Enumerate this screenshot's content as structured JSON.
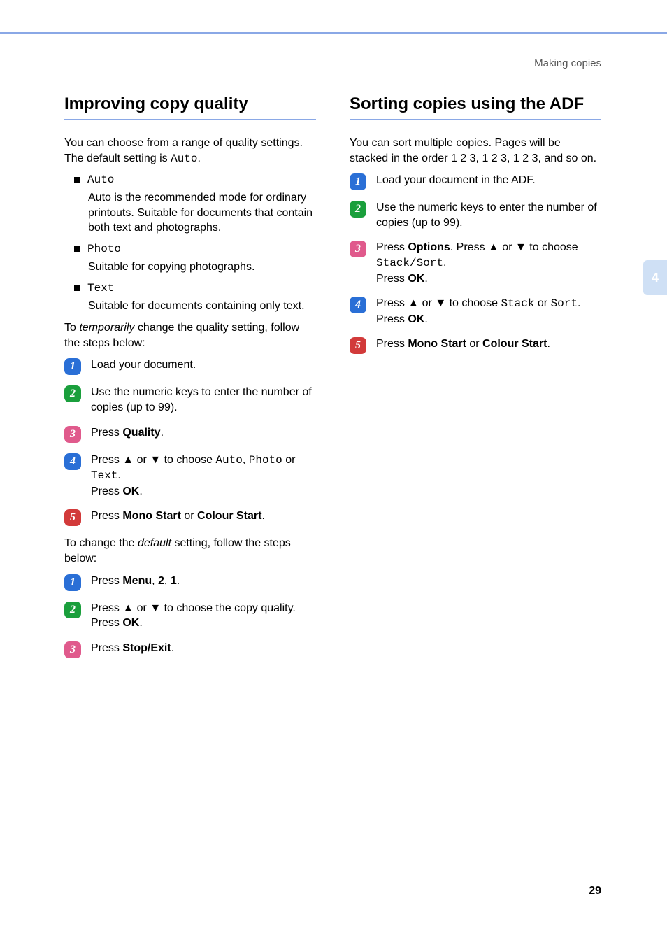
{
  "breadcrumb": "Making copies",
  "page_number": "29",
  "side_tab": "4",
  "left": {
    "heading": "Improving copy quality",
    "intro_a": "You can choose from a range of quality settings. The default setting is ",
    "intro_code": "Auto",
    "intro_b": ".",
    "bullets": [
      {
        "label": "Auto",
        "desc": "Auto is the recommended mode for ordinary printouts. Suitable for documents that contain both text and photographs."
      },
      {
        "label": "Photo",
        "desc": "Suitable for copying photographs."
      },
      {
        "label": "Text",
        "desc": "Suitable for documents containing only text."
      }
    ],
    "temp_a": "To ",
    "temp_em": "temporarily",
    "temp_b": " change the quality setting, follow the steps below:",
    "stepsA": {
      "s1": "Load your document.",
      "s2": "Use the numeric keys to enter the number of copies (up to 99).",
      "s3_a": "Press ",
      "s3_b": "Quality",
      "s3_c": ".",
      "s4_a": "Press ",
      "s4_up": "▲",
      "s4_or1": " or ",
      "s4_dn": "▼",
      "s4_mid": " to choose ",
      "s4_opt1": "Auto",
      "s4_sep1": ", ",
      "s4_opt2": "Photo",
      "s4_sep2": " or ",
      "s4_opt3": "Text",
      "s4_end": ".",
      "s4_press": "Press ",
      "s4_ok": "OK",
      "s4_dot": ".",
      "s5_a": "Press ",
      "s5_b": "Mono Start",
      "s5_c": " or ",
      "s5_d": "Colour Start",
      "s5_e": "."
    },
    "default_a": "To change the ",
    "default_em": "default",
    "default_b": " setting, follow the steps below:",
    "stepsB": {
      "s1_a": "Press ",
      "s1_b": "Menu",
      "s1_c": ", ",
      "s1_d": "2",
      "s1_e": ", ",
      "s1_f": "1",
      "s1_g": ".",
      "s2_a": "Press ",
      "s2_up": "▲",
      "s2_or": " or ",
      "s2_dn": "▼",
      "s2_mid": " to choose the copy quality.",
      "s2_press": "Press ",
      "s2_ok": "OK",
      "s2_dot": ".",
      "s3_a": "Press ",
      "s3_b": "Stop/Exit",
      "s3_c": "."
    }
  },
  "right": {
    "heading": "Sorting copies using the ADF",
    "intro": "You can sort multiple copies. Pages will be stacked in the order 1 2 3, 1 2 3, 1 2 3, and so on.",
    "steps": {
      "s1": "Load your document in the ADF.",
      "s2": "Use the numeric keys to enter the number of copies (up to 99).",
      "s3_a": "Press ",
      "s3_b": "Options",
      "s3_c": ". Press ",
      "s3_up": "▲",
      "s3_or": " or ",
      "s3_dn": "▼",
      "s3_mid": " to choose ",
      "s3_code": "Stack/Sort",
      "s3_end": ".",
      "s3_press": "Press ",
      "s3_ok": "OK",
      "s3_dot": ".",
      "s4_a": "Press ",
      "s4_up": "▲",
      "s4_or": " or ",
      "s4_dn": "▼",
      "s4_mid": " to choose ",
      "s4_c1": "Stack",
      "s4_or2": " or ",
      "s4_c2": "Sort",
      "s4_end": ".",
      "s4_press": "Press ",
      "s4_ok": "OK",
      "s4_dot": ".",
      "s5_a": "Press ",
      "s5_b": "Mono Start",
      "s5_c": " or ",
      "s5_d": "Colour Start",
      "s5_e": "."
    }
  }
}
